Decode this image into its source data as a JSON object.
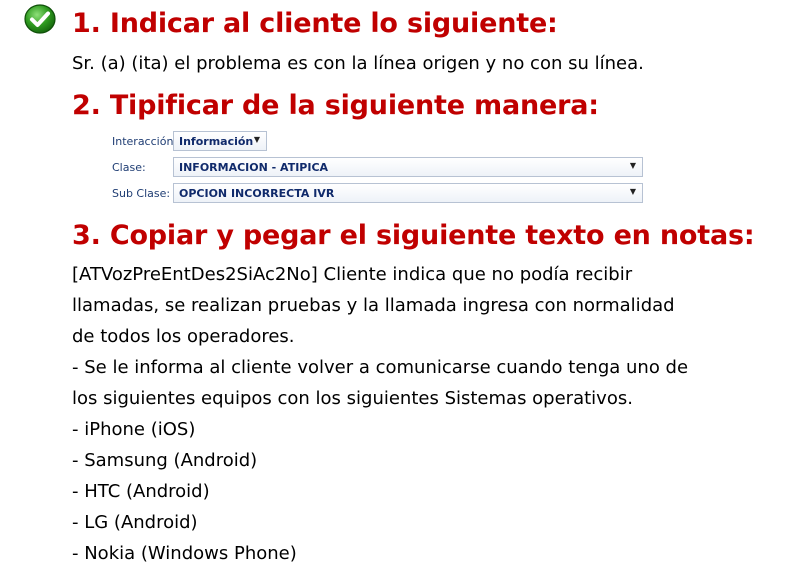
{
  "icons": {
    "check": "check-circle-icon",
    "check_color": "#2e9a1f"
  },
  "colors": {
    "heading": "#c00000",
    "form_label": "#1f3d73",
    "form_value": "#102a6b"
  },
  "step1": {
    "heading": "1. Indicar al cliente lo siguiente:",
    "text": "Sr. (a) (ita) el problema es con la línea origen y no con su línea."
  },
  "step2": {
    "heading": "2. Tipificar de la siguiente manera:",
    "form": {
      "interaccion_label": "Interacción:",
      "interaccion_value": "Información",
      "clase_label": "Clase:",
      "clase_value": "INFORMACION - ATIPICA",
      "subclase_label": "Sub Clase:",
      "subclase_value": "OPCION INCORRECTA IVR"
    }
  },
  "step3": {
    "heading": "3. Copiar y pegar el siguiente texto en notas:",
    "lines": [
      "[ATVozPreEntDes2SiAc2No] Cliente indica que no podía recibir",
      "llamadas, se realizan pruebas y la llamada ingresa con normalidad",
      "de todos los operadores.",
      "- Se le informa al cliente volver a comunicarse cuando tenga uno de",
      "los siguientes equipos con los siguientes Sistemas operativos.",
      "- iPhone (iOS)",
      "- Samsung (Android)",
      "- HTC (Android)",
      "- LG (Android)",
      "- Nokia (Windows Phone)"
    ]
  }
}
